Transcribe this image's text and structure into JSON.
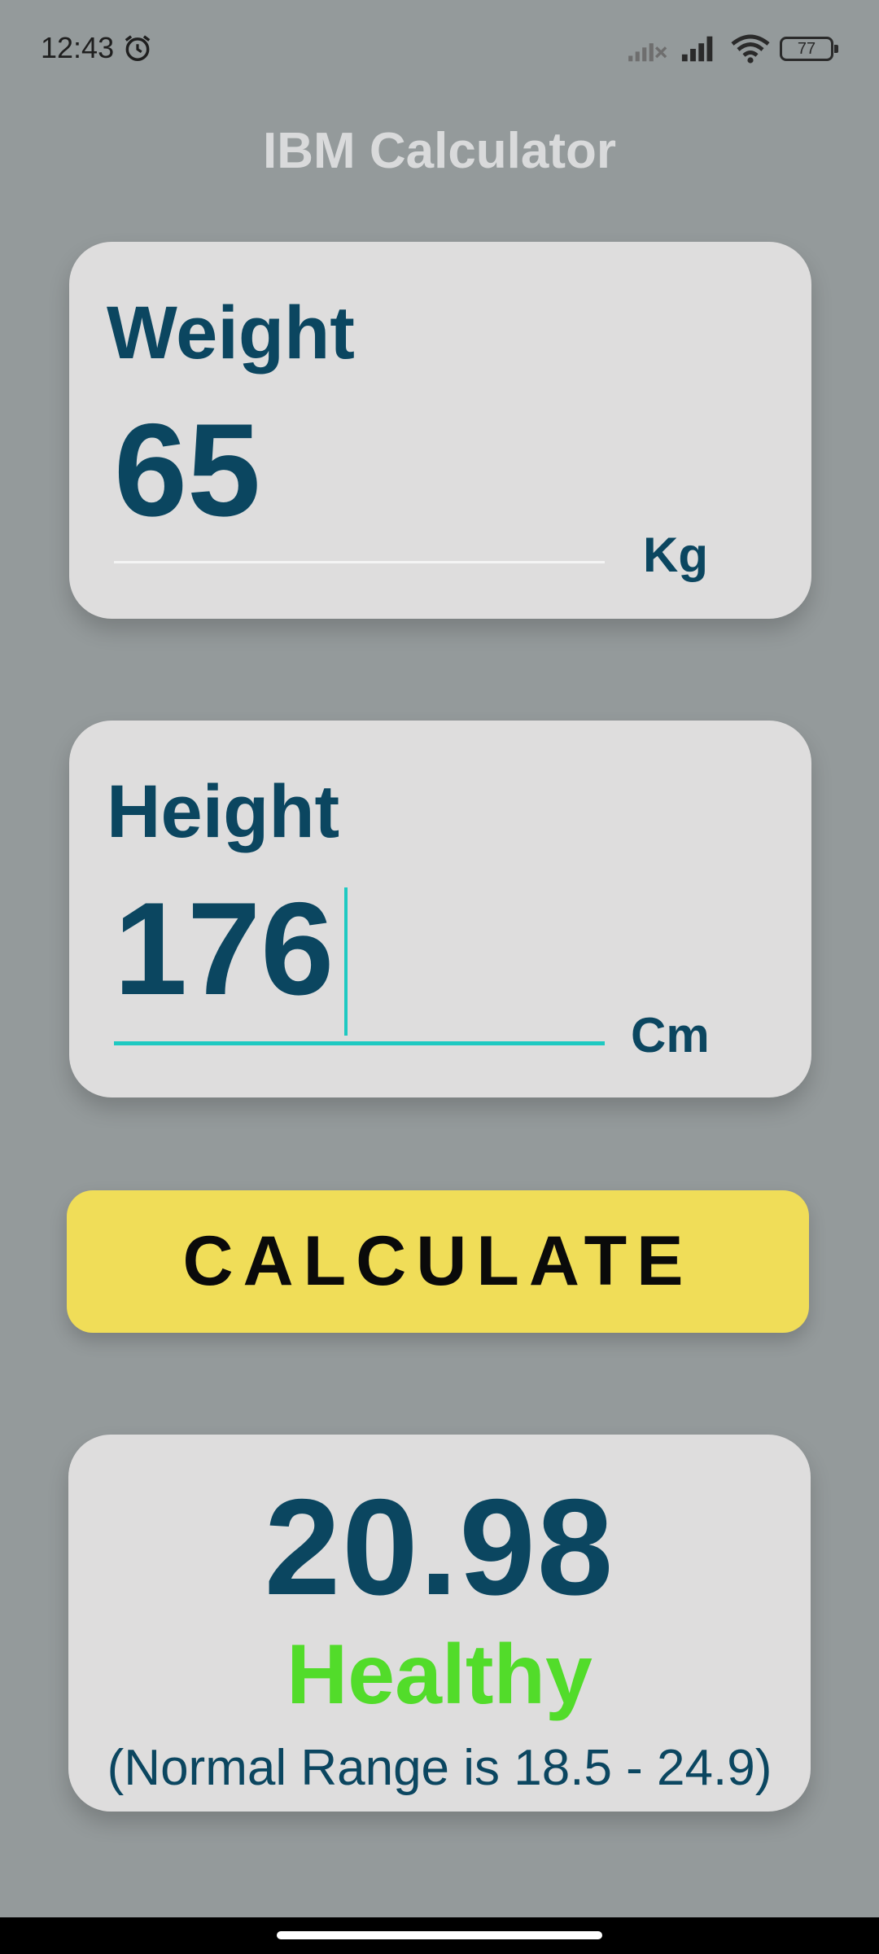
{
  "status_bar": {
    "time": "12:43",
    "battery": "77",
    "icons": [
      "alarm-icon",
      "no-signal-icon",
      "signal-icon",
      "wifi-icon",
      "battery-icon"
    ]
  },
  "app": {
    "title": "IBM Calculator"
  },
  "weight": {
    "label": "Weight",
    "value": "65",
    "unit": "Kg"
  },
  "height": {
    "label": "Height",
    "value": "176",
    "unit": "Cm"
  },
  "calculate_button": {
    "label": "CALCULATE"
  },
  "result": {
    "value": "20.98",
    "status": "Healthy",
    "range": "(Normal Range is 18.5 - 24.9)"
  },
  "colors": {
    "background": "#949a9b",
    "card": "#dedddd",
    "primary_text": "#0b4660",
    "accent_underline": "#1ec9c1",
    "button": "#f0dd58",
    "healthy": "#52dc2a"
  }
}
